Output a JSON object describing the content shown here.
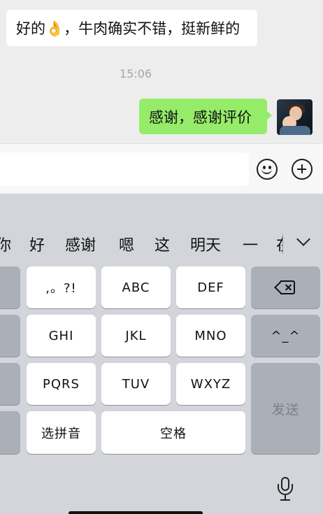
{
  "chat": {
    "received_message": "好的👌，牛肉确实不错，挺新鲜的",
    "timestamp": "15:06",
    "sent_message": "感谢，感谢评价"
  },
  "input": {
    "value": "",
    "placeholder": ""
  },
  "icons": {
    "emoji": "smiley-face-icon",
    "add": "plus-circle-icon",
    "backspace": "backspace-icon",
    "expand_candidates": "chevron-down-icon",
    "voice": "microphone-icon"
  },
  "keyboard": {
    "candidates": [
      "你",
      "好",
      "感谢",
      "嗯",
      "这",
      "明天",
      "一",
      "在"
    ],
    "keys": {
      "punct": ",。?!",
      "abc": "ABC",
      "def": "DEF",
      "emoticon": "^_^",
      "ghi": "GHI",
      "jkl": "JKL",
      "mno": "MNO",
      "pqrs": "PQRS",
      "tuv": "TUV",
      "wxyz": "WXYZ",
      "pinyin": "选拼音",
      "space": "空格",
      "send": "发送"
    }
  },
  "colors": {
    "chat_background": "#ededed",
    "sent_bubble": "#95ec69",
    "received_bubble": "#ffffff",
    "keyboard_background": "#d3d5da",
    "key_white": "#ffffff",
    "key_gray": "#abafb8"
  }
}
